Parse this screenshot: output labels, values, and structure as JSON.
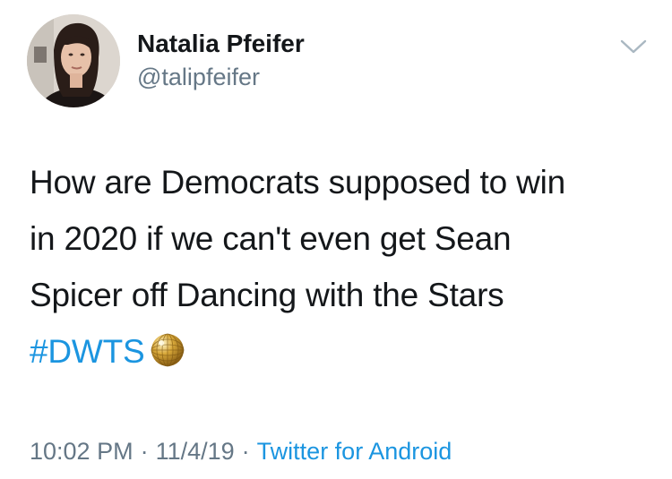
{
  "author": {
    "display_name": "Natalia Pfeifer",
    "handle": "@talipfeifer",
    "avatar_icon": "profile-photo"
  },
  "menu": {
    "icon": "chevron-down-icon"
  },
  "tweet": {
    "lines": [
      "How are Democrats supposed to win",
      "in 2020 if we can't even get Sean",
      "Spicer off Dancing with the Stars"
    ],
    "hashtag": "#DWTS",
    "emoji": "disco-ball-icon"
  },
  "meta": {
    "time": "10:02 PM",
    "separator": "·",
    "date": "11/4/19",
    "source": "Twitter for Android"
  },
  "colors": {
    "link": "#1b95e0",
    "secondary_text": "#657786",
    "primary_text": "#14171a"
  }
}
